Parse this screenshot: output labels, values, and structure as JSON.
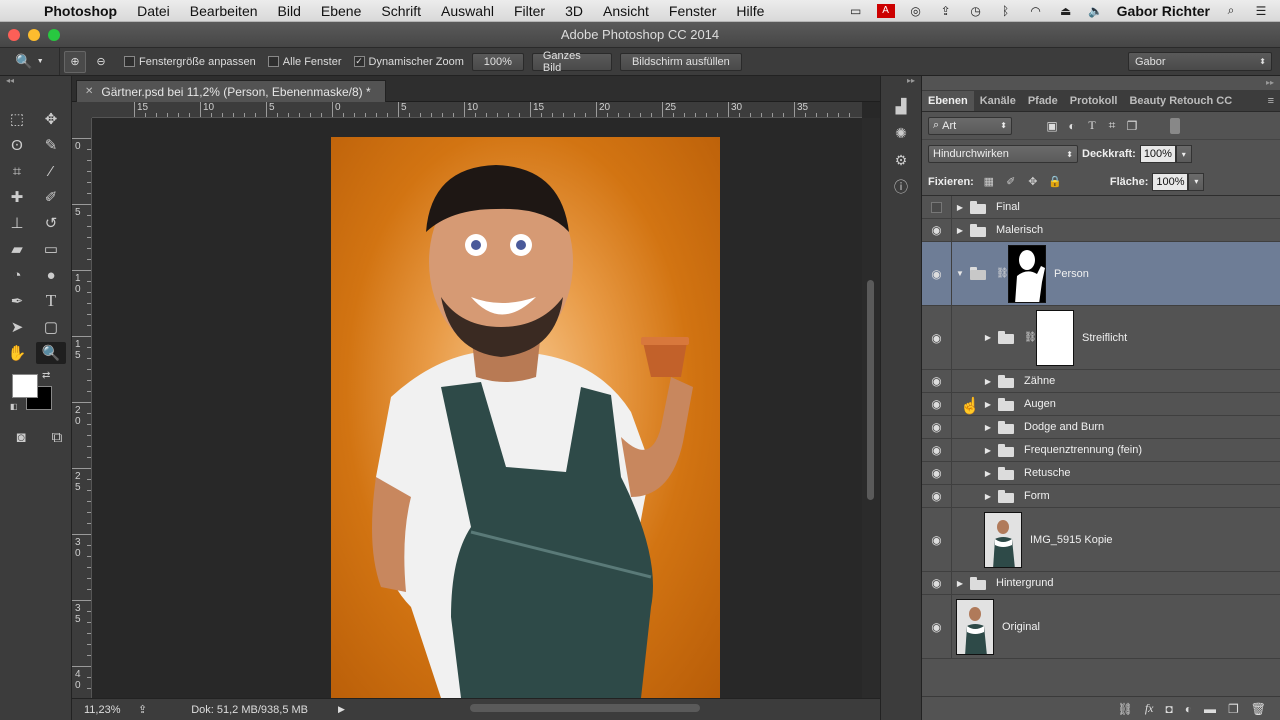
{
  "menubar": {
    "app_name": "Photoshop",
    "items": [
      "Datei",
      "Bearbeiten",
      "Bild",
      "Ebene",
      "Schrift",
      "Auswahl",
      "Filter",
      "3D",
      "Ansicht",
      "Fenster",
      "Hilfe"
    ],
    "user": "Gabor Richter"
  },
  "window": {
    "title": "Adobe Photoshop CC 2014"
  },
  "options_bar": {
    "resize_windows_label": "Fenstergröße anpassen",
    "all_windows_label": "Alle Fenster",
    "scrubby_zoom_label": "Dynamischer Zoom",
    "scrubby_zoom_checked": "✓",
    "btn_100": "100%",
    "btn_fit": "Ganzes Bild",
    "btn_fill": "Bildschirm ausfüllen",
    "workspace": "Gabor"
  },
  "document": {
    "tab_title": "Gärtner.psd bei 11,2% (Person, Ebenenmaske/8) *",
    "zoom": "11,23%",
    "doc_size": "Dok: 51,2 MB/938,5 MB"
  },
  "rulers": {
    "horizontal": [
      "15",
      "10",
      "5",
      "0",
      "5",
      "10",
      "15",
      "20",
      "25",
      "30",
      "35"
    ],
    "vertical": [
      "0",
      "5",
      "1\n0",
      "1\n5",
      "2\n0",
      "2\n5",
      "3\n0",
      "3\n5",
      "4\n0"
    ]
  },
  "layers_panel": {
    "tabs": [
      "Ebenen",
      "Kanäle",
      "Pfade",
      "Protokoll",
      "Beauty Retouch CC"
    ],
    "active_tab": "Ebenen",
    "filter_kind": "Art",
    "blend_mode": "Hindurchwirken",
    "opacity_label": "Deckkraft:",
    "opacity_value": "100%",
    "lock_label": "Fixieren:",
    "fill_label": "Fläche:",
    "fill_value": "100%",
    "layers": [
      {
        "name": "Final",
        "visible": false
      },
      {
        "name": "Malerisch",
        "visible": true
      },
      {
        "name": "Person",
        "visible": true,
        "selected": true
      },
      {
        "name": "Streiflicht",
        "visible": true
      },
      {
        "name": "Zähne",
        "visible": true
      },
      {
        "name": "Augen",
        "visible": true
      },
      {
        "name": "Dodge and Burn",
        "visible": true
      },
      {
        "name": "Frequenztrennung (fein)",
        "visible": true
      },
      {
        "name": "Retusche",
        "visible": true
      },
      {
        "name": "Form",
        "visible": true
      },
      {
        "name": "IMG_5915 Kopie",
        "visible": true
      },
      {
        "name": "Hintergrund",
        "visible": true
      },
      {
        "name": "Original",
        "visible": true
      }
    ]
  },
  "colors": {
    "selected_layer": "#6e7d96",
    "canvas_orange": "#d27412"
  }
}
